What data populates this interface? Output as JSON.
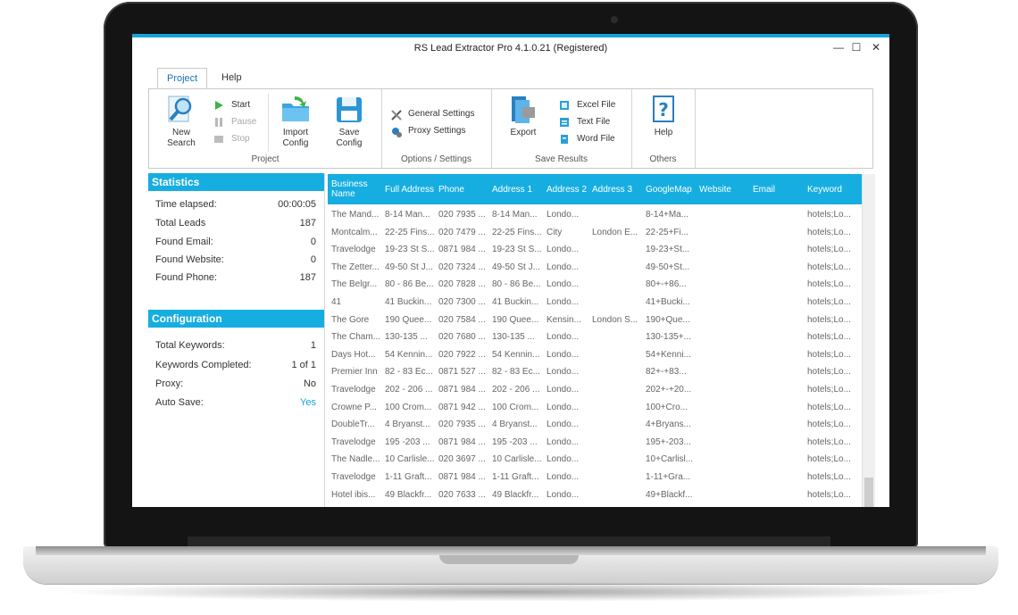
{
  "window": {
    "title": "RS Lead Extractor Pro 4.1.0.21 (Registered)",
    "minimize": "—",
    "maximize": "☐",
    "close": "✕"
  },
  "menu": {
    "tabs": [
      {
        "label": "Project"
      },
      {
        "label": "Help"
      }
    ]
  },
  "ribbon": {
    "project": {
      "label": "Project",
      "new_search": "New Search",
      "start": "Start",
      "pause": "Pause",
      "stop": "Stop",
      "import_config": "Import Config",
      "save_config": "Save Config"
    },
    "options": {
      "label": "Options / Settings",
      "general": "General Settings",
      "proxy": "Proxy Settings"
    },
    "save": {
      "label": "Save Results",
      "export": "Export",
      "excel": "Excel File",
      "text": "Text File",
      "word": "Word File"
    },
    "others": {
      "label": "Others",
      "help": "Help"
    }
  },
  "statistics": {
    "title": "Statistics",
    "rows": [
      {
        "label": "Time elapsed:",
        "value": "00:00:05"
      },
      {
        "label": "Total Leads",
        "value": "187"
      },
      {
        "label": "Found Email:",
        "value": "0"
      },
      {
        "label": "Found Website:",
        "value": "0"
      },
      {
        "label": "Found Phone:",
        "value": "187"
      }
    ]
  },
  "configuration": {
    "title": "Configuration",
    "rows": [
      {
        "label": "Total Keywords:",
        "value": "1"
      },
      {
        "label": "Keywords Completed:",
        "value": "1 of 1"
      },
      {
        "label": "Proxy:",
        "value": "No"
      },
      {
        "label": "Auto Save:",
        "value": "Yes"
      }
    ]
  },
  "grid": {
    "columns": [
      "Business Name",
      "Full Address",
      "Phone",
      "Address 1",
      "Address 2",
      "Address 3",
      "GoogleMap",
      "Website",
      "Email",
      "Keyword"
    ],
    "rows": [
      [
        "The Mand...",
        "8-14 Man...",
        "020 7935 ...",
        "8-14 Man...",
        "Londo...",
        "",
        "8-14+Ma...",
        "",
        "",
        "hotels;Lo..."
      ],
      [
        "Montcalm...",
        "22-25 Fins...",
        "020 7479 ...",
        "22-25 Fins...",
        "City",
        "London E...",
        "22-25+Fi...",
        "",
        "",
        "hotels;Lo..."
      ],
      [
        "Travelodge",
        "19-23 St S...",
        "0871 984 ...",
        "19-23 St S...",
        "Londo...",
        "",
        "19-23+St...",
        "",
        "",
        "hotels;Lo..."
      ],
      [
        "The Zetter...",
        "49-50 St J...",
        "020 7324 ...",
        "49-50 St J...",
        "Londo...",
        "",
        "49-50+St...",
        "",
        "",
        "hotels;Lo..."
      ],
      [
        "The Belgr...",
        "80 - 86 Be...",
        "020 7828 ...",
        "80 - 86 Be...",
        "Londo...",
        "",
        "80+-+86...",
        "",
        "",
        "hotels;Lo..."
      ],
      [
        "41",
        "41 Buckin...",
        "020 7300 ...",
        "41 Buckin...",
        "Londo...",
        "",
        "41+Bucki...",
        "",
        "",
        "hotels;Lo..."
      ],
      [
        "The Gore",
        "190 Quee...",
        "020 7584 ...",
        "190 Quee...",
        "Kensin...",
        "London S...",
        "190+Que...",
        "",
        "",
        "hotels;Lo..."
      ],
      [
        "The Cham...",
        "130-135 ...",
        "020 7680 ...",
        "130-135 ...",
        "Londo...",
        "",
        "130-135+...",
        "",
        "",
        "hotels;Lo..."
      ],
      [
        "Days Hot...",
        "54 Kennin...",
        "020 7922 ...",
        "54 Kennin...",
        "Londo...",
        "",
        "54+Kenni...",
        "",
        "",
        "hotels;Lo..."
      ],
      [
        "Premier Inn",
        "82 - 83 Ec...",
        "0871 527 ...",
        "82 - 83 Ec...",
        "Londo...",
        "",
        "82+-+83...",
        "",
        "",
        "hotels;Lo..."
      ],
      [
        "Travelodge",
        "202 - 206 ...",
        "0871 984 ...",
        "202 - 206 ...",
        "Londo...",
        "",
        "202+-+20...",
        "",
        "",
        "hotels;Lo..."
      ],
      [
        "Crowne P...",
        "100 Crom...",
        "0871 942 ...",
        "100 Crom...",
        "Londo...",
        "",
        "100+Cro...",
        "",
        "",
        "hotels;Lo..."
      ],
      [
        "DoubleTr...",
        "4 Bryanst...",
        "020 7935 ...",
        "4 Bryanst...",
        "Londo...",
        "",
        "4+Bryans...",
        "",
        "",
        "hotels;Lo..."
      ],
      [
        "Travelodge",
        "195 -203 ...",
        "0871 984 ...",
        "195 -203 ...",
        "Londo...",
        "",
        "195+-203...",
        "",
        "",
        "hotels;Lo..."
      ],
      [
        "The Nadle...",
        "10 Carlisle...",
        "020 3697 ...",
        "10 Carlisle...",
        "Londo...",
        "",
        "10+Carlisl...",
        "",
        "",
        "hotels;Lo..."
      ],
      [
        "Travelodge",
        "1-11 Graft...",
        "0871 984 ...",
        "1-11 Graft...",
        "Londo...",
        "",
        "1-11+Gra...",
        "",
        "",
        "hotels;Lo..."
      ],
      [
        "Hotel ibis...",
        "49 Blackfr...",
        "020 7633 ...",
        "49 Blackfr...",
        "Londo...",
        "",
        "49+Blackf...",
        "",
        "",
        "hotels;Lo..."
      ]
    ]
  }
}
